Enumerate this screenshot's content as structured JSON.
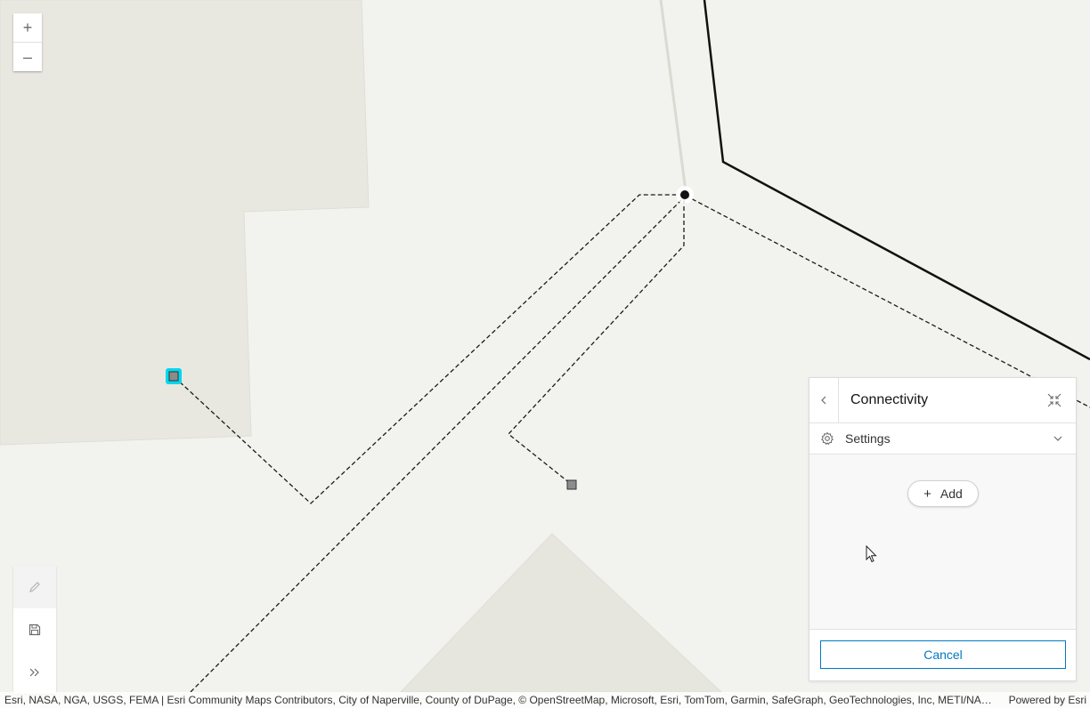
{
  "zoom": {
    "in_label": "+",
    "out_label": "–"
  },
  "panel": {
    "title": "Connectivity",
    "settings_label": "Settings",
    "add_label": "Add",
    "cancel_label": "Cancel"
  },
  "attribution": {
    "text": "Esri, NASA, NGA, USGS, FEMA | Esri Community Maps Contributors, City of Naperville, County of DuPage, © OpenStreetMap, Microsoft, Esri, TomTom, Garmin, SafeGraph, GeoTechnologies, Inc, METI/NAS…",
    "powered": "Powered by Esri"
  },
  "icons": {
    "edit": "pencil-icon",
    "save": "save-icon",
    "expand": "chevrons-right-icon",
    "back": "chevron-left-icon",
    "collapse": "shrink-icon",
    "settings": "gear-icon",
    "dropdown": "chevron-down-icon"
  },
  "colors": {
    "map_background": "#f2f3ee",
    "parcel_fill": "#e7e7e0",
    "selection": "#00d7ee",
    "accent": "#007ac2"
  }
}
